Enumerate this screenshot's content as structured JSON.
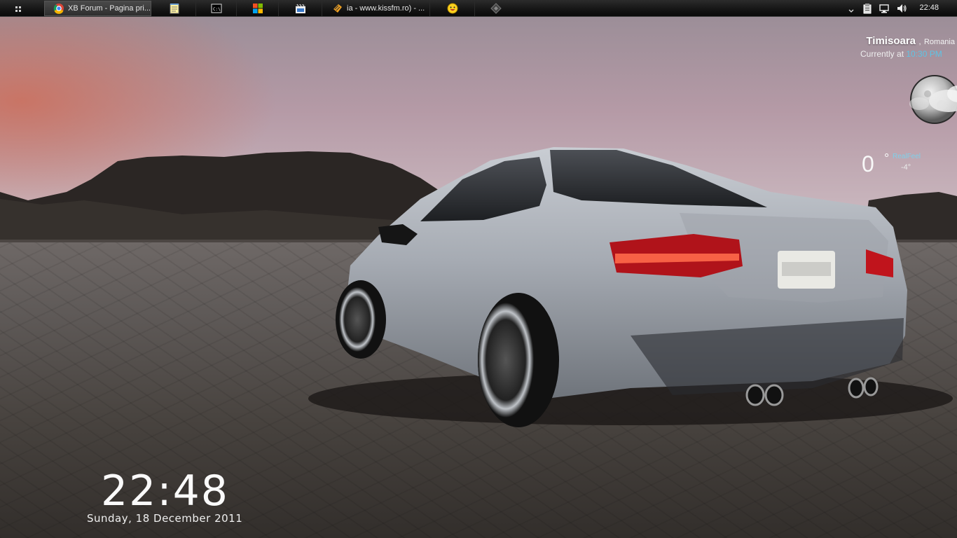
{
  "taskbar": {
    "tasks": [
      {
        "label": "XB Forum - Pagina pri...",
        "icon": "chrome-icon",
        "active": true
      },
      {
        "label": "",
        "icon": "notepad-icon"
      },
      {
        "label": "",
        "icon": "command-prompt-icon"
      },
      {
        "label": "",
        "icon": "windows-logo-icon"
      },
      {
        "label": "",
        "icon": "video-editor-icon"
      },
      {
        "label": "ia - www.kissfm.ro) - ...",
        "icon": "winamp-icon"
      },
      {
        "label": "",
        "icon": "yahoo-messenger-icon"
      },
      {
        "label": "",
        "icon": "app-icon"
      }
    ],
    "tray": {
      "clock": "22:48",
      "icons": [
        "chevron-up-icon",
        "clipboard-icon",
        "network-icon",
        "volume-icon"
      ]
    }
  },
  "weather": {
    "city": "Timisoara",
    "separator": ",",
    "country": "Romania",
    "currently_label": "Currently at",
    "currently_time": "10:30 PM",
    "condition_icon": "cloudy-moon-icon",
    "temperature": "0",
    "degree_symbol": "°",
    "realfeel_label": "RealFeel",
    "realfeel_value": "-4°"
  },
  "desktop_clock": {
    "time": "22:48",
    "date": "Sunday, 18 December 2011"
  },
  "colors": {
    "accent": "#5fc3e4",
    "taskbar": "#161616"
  }
}
